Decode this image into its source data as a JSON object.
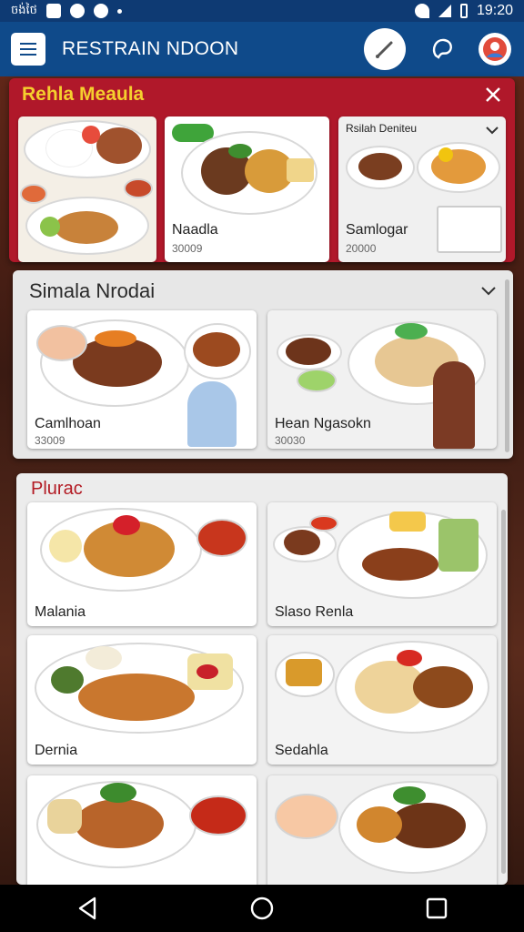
{
  "status_bar": {
    "left_text": "ចង់ថៃ",
    "time": "19:20"
  },
  "app_bar": {
    "title": "RESTRAIN NDOON"
  },
  "panel_featured": {
    "title": "Rehla Meaula",
    "cards": [
      {
        "name": "",
        "price": ""
      },
      {
        "name": "Naadla",
        "price": "30009",
        "badge_color": "#3fa43a"
      },
      {
        "title": "Rsilah Deniteu",
        "name": "Samlogar",
        "price": "20000"
      }
    ]
  },
  "panel_second": {
    "title": "Simala Nrodai",
    "cards": [
      {
        "name": "Camlhoan",
        "price": "33009"
      },
      {
        "name": "Hean Ngasokn",
        "price": "30030"
      }
    ]
  },
  "panel_third": {
    "title": "Plurac",
    "cards": [
      {
        "name": "Malania"
      },
      {
        "name": "Slaso Renla"
      },
      {
        "name": "Dernia"
      },
      {
        "name": "Sedahla"
      },
      {
        "name": ""
      },
      {
        "name": ""
      }
    ]
  },
  "colors": {
    "app_bar": "#0f4a8a",
    "status_bar": "#0e3a73",
    "featured_panel": "#b0182a",
    "featured_title": "#f5cf2e",
    "section_title_red": "#b31b24"
  },
  "icons": [
    "menu-icon",
    "pen-icon",
    "bean-icon",
    "avatar-icon",
    "close-icon",
    "chevron-down-icon",
    "back-icon",
    "home-icon",
    "recents-icon"
  ]
}
